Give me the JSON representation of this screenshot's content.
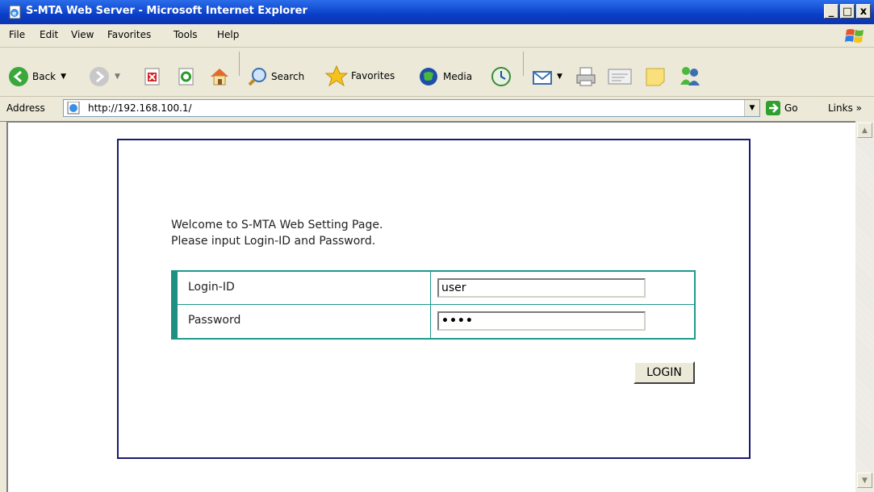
{
  "window": {
    "title": "S-MTA Web Server - Microsoft Internet Explorer",
    "minimize": "_",
    "maximize": "□",
    "close": "x"
  },
  "menu": [
    "File",
    "Edit",
    "View",
    "Favorites",
    "Tools",
    "Help"
  ],
  "toolbar": {
    "back": "Back",
    "search": "Search",
    "favorites": "Favorites",
    "media": "Media"
  },
  "address": {
    "label": "Address",
    "url": "http://192.168.100.1/",
    "go": "Go",
    "links": "Links »"
  },
  "page": {
    "welcome_line1": "Welcome to S-MTA Web Setting Page.",
    "welcome_line2": "Please input Login-ID and Password.",
    "login_id_label": "Login-ID",
    "login_id_value": "user",
    "password_label": "Password",
    "password_value": "••••",
    "login_button": "LOGIN"
  },
  "colors": {
    "titlebar": "#0a3fc8",
    "frame_border": "#1a1a6e",
    "table_border": "#1e9a8c"
  }
}
